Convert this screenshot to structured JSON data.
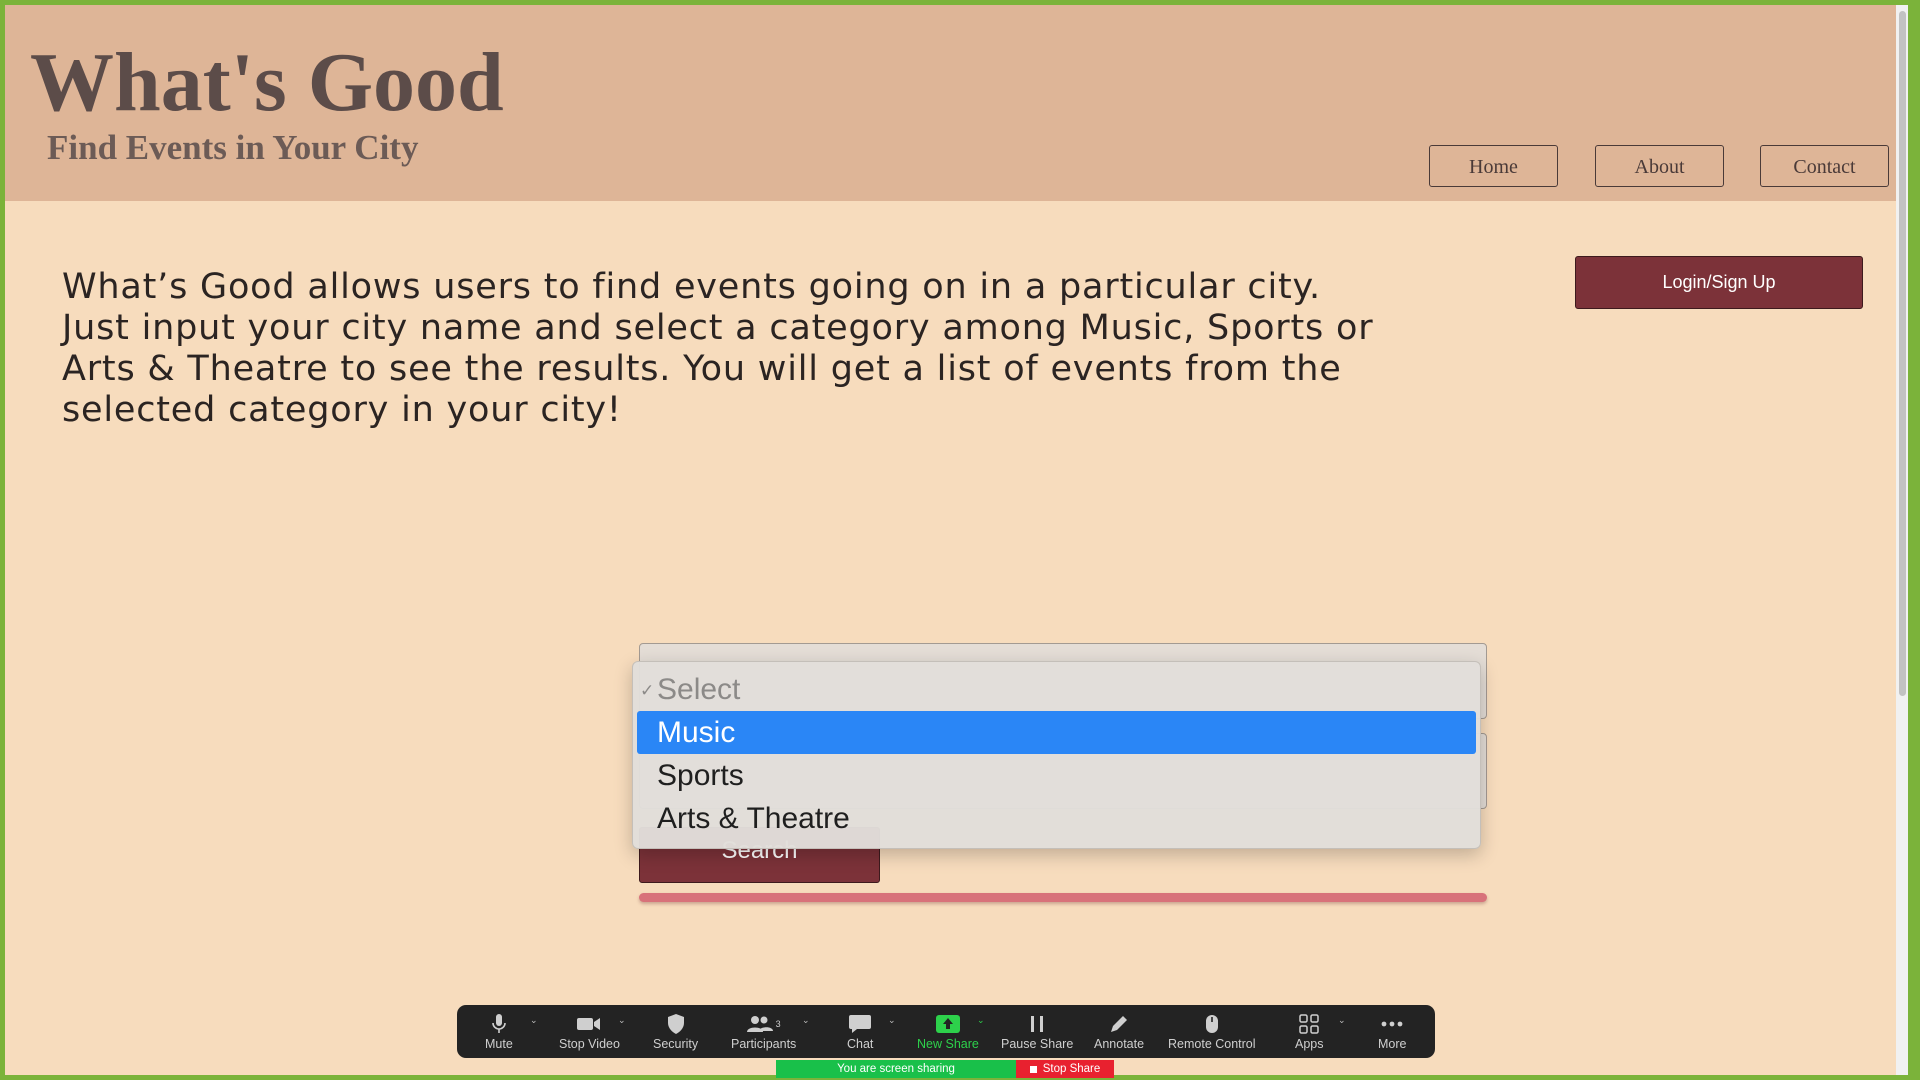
{
  "header": {
    "title": "What's Good",
    "subtitle": "Find Events in Your City",
    "nav": [
      {
        "label": "Home"
      },
      {
        "label": "About"
      },
      {
        "label": "Contact"
      }
    ]
  },
  "main": {
    "intro": "What’s Good allows users to find events going on in a particular city. Just input your city name and select a category among Music, Sports or Arts & Theatre to see the results. You will get a list of events from the selected category in your city!",
    "login_label": "Login/Sign Up",
    "search_label": "Search"
  },
  "category_dropdown": {
    "options": [
      {
        "label": "Select",
        "state": "current-disabled"
      },
      {
        "label": "Music",
        "state": "highlighted"
      },
      {
        "label": "Sports",
        "state": "normal"
      },
      {
        "label": "Arts & Theatre",
        "state": "normal"
      }
    ],
    "highlight_color": "#2a86f6"
  },
  "zoom_toolbar": {
    "items": [
      {
        "label": "Mute",
        "icon": "microphone-icon"
      },
      {
        "label": "Stop Video",
        "icon": "video-camera-icon"
      },
      {
        "label": "Security",
        "icon": "shield-icon"
      },
      {
        "label": "Participants",
        "icon": "participants-icon",
        "count": "3"
      },
      {
        "label": "Chat",
        "icon": "chat-bubble-icon"
      },
      {
        "label": "New Share",
        "icon": "share-screen-icon"
      },
      {
        "label": "Pause Share",
        "icon": "pause-icon"
      },
      {
        "label": "Annotate",
        "icon": "pencil-icon"
      },
      {
        "label": "Remote Control",
        "icon": "mouse-icon"
      },
      {
        "label": "Apps",
        "icon": "apps-icon"
      },
      {
        "label": "More",
        "icon": "more-dots-icon"
      }
    ],
    "sharing_status": "You are screen sharing",
    "stop_share_label": "Stop Share"
  },
  "colors": {
    "page_bg": "#f7dcbd",
    "header_bg": "#deb597",
    "accent_button": "#7c3239",
    "progress": "#d8727a",
    "zoom_green": "#2dd14b",
    "stop_red": "#e8212f"
  }
}
